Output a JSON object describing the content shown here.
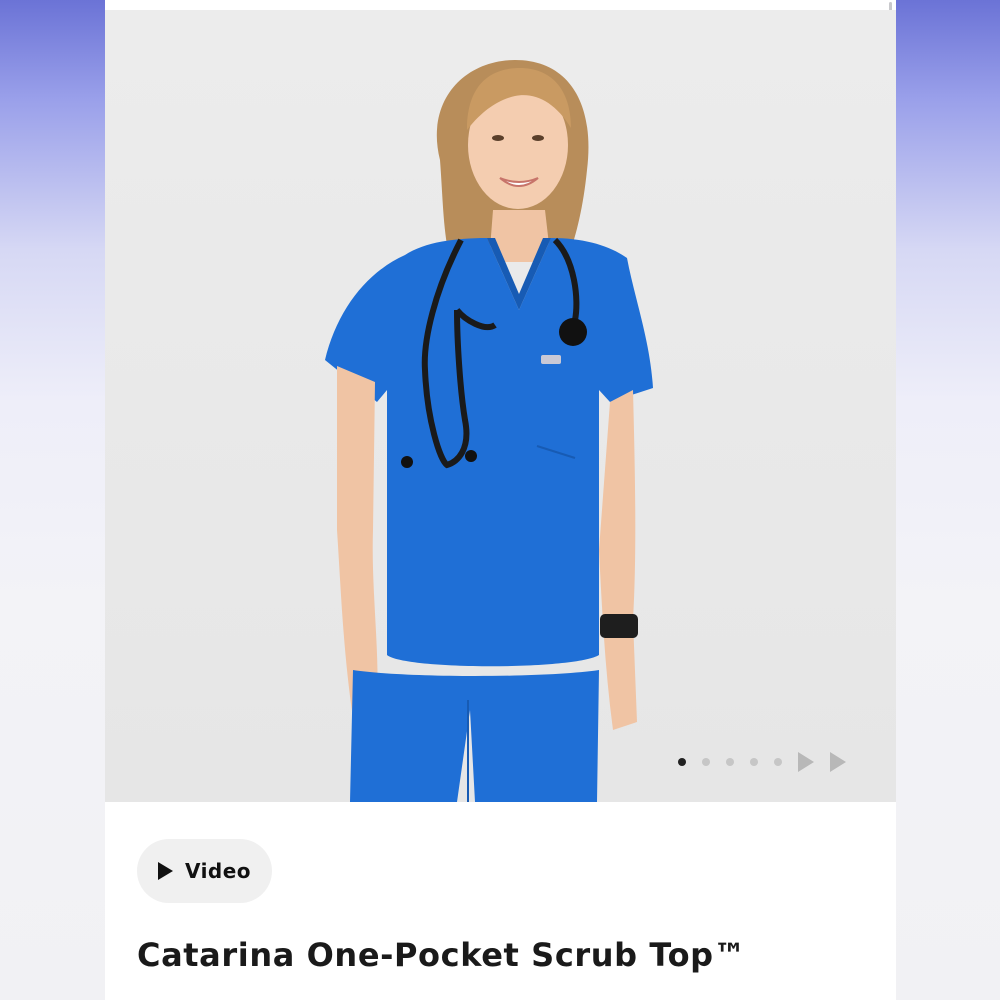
{
  "product": {
    "title": "Catarina One-Pocket Scrub Top™",
    "image_alt": "Woman wearing royal blue scrub top with stethoscope",
    "color": "#1f6fd6"
  },
  "gallery": {
    "total_dots": 5,
    "active_index": 0,
    "icons": [
      "next-arrow-icon",
      "next-arrow-icon"
    ]
  },
  "video_button": {
    "label": "Video",
    "icon": "play-icon"
  }
}
